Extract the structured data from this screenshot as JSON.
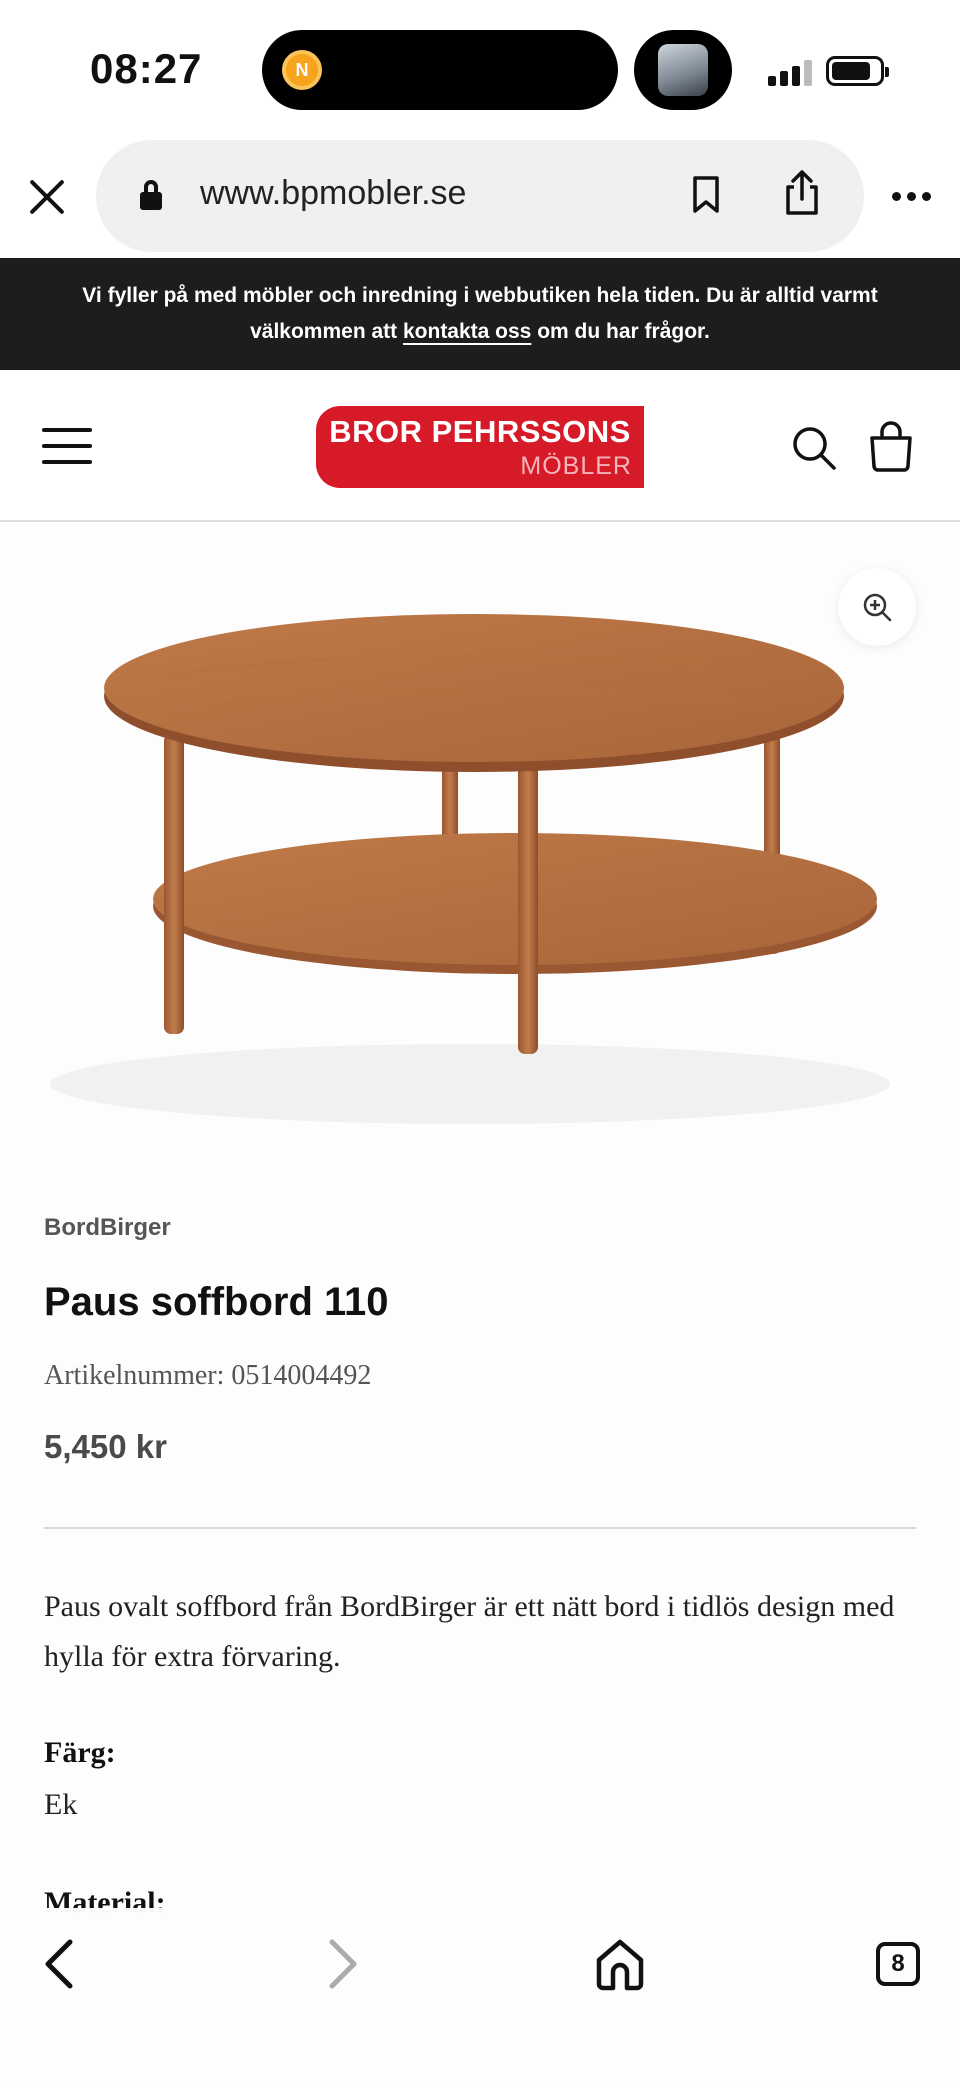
{
  "status_bar": {
    "time": "08:27",
    "island_icon_letter": "N"
  },
  "browser": {
    "url": "www.bpmobler.se",
    "tab_count": "8"
  },
  "announcement": {
    "line1": "Vi fyller på med möbler och inredning i webbutiken hela tiden. Du är alltid varmt",
    "line2_before": "välkommen att ",
    "link": "kontakta oss",
    "line2_after": " om du har frågor."
  },
  "header": {
    "logo_top": "BROR PEHRSSONS",
    "logo_bottom": "MÖBLER"
  },
  "product": {
    "brand": "BordBirger",
    "title": "Paus soffbord 110",
    "article_number": "Artikelnummer: 0514004492",
    "price": "5,450 kr",
    "description": "Paus ovalt soffbord från BordBirger är ett nätt bord i tidlös design med hylla för extra förvaring.",
    "specs": [
      {
        "label": "Färg:",
        "value": "Ek"
      },
      {
        "label": "Material:",
        "value": ""
      }
    ]
  },
  "colors": {
    "brand_red": "#d71a28",
    "announce_bg": "#1d1d1d",
    "wood": "#b06a3c"
  }
}
